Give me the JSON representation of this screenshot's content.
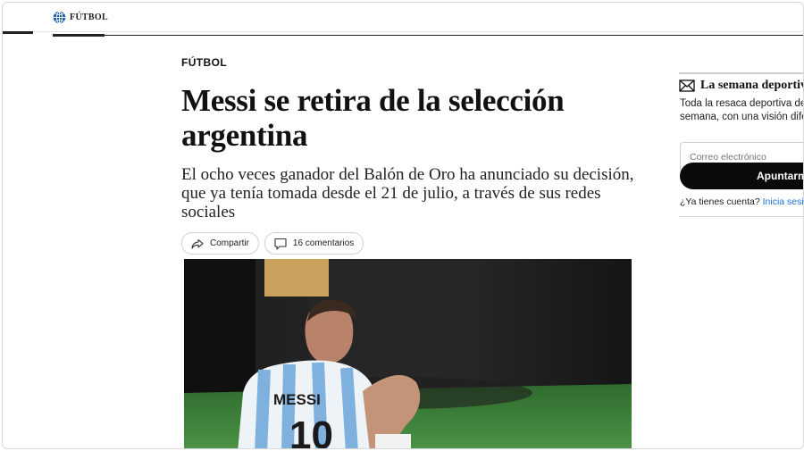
{
  "header": {
    "brand": "FÚTBOL"
  },
  "article": {
    "section": "FÚTBOL",
    "headline": "Messi se retira de la selección argentina",
    "subtitle": "El ocho veces ganador del Balón de Oro ha anunciado su decisión, que ya tenía tomada desde el 21 de julio, a través de sus redes sociales",
    "share_label": "Compartir",
    "comments_label": "16 comentarios",
    "hero": {
      "jersey_name": "MESSI",
      "jersey_number": "10"
    }
  },
  "newsletter": {
    "title": "La semana deportiva",
    "desc_line1": "Toda la resaca deportiva del fin de",
    "desc_line2": "semana, con una visión diferente",
    "email_placeholder": "Correo electrónico",
    "button_label": "Apuntarme",
    "login_prompt": "¿Ya tienes cuenta?",
    "login_link": "Inicia sesión"
  },
  "colors": {
    "link": "#1a6fd6",
    "button_bg": "#0a0a0a",
    "pitch": "#3f8a3c"
  }
}
